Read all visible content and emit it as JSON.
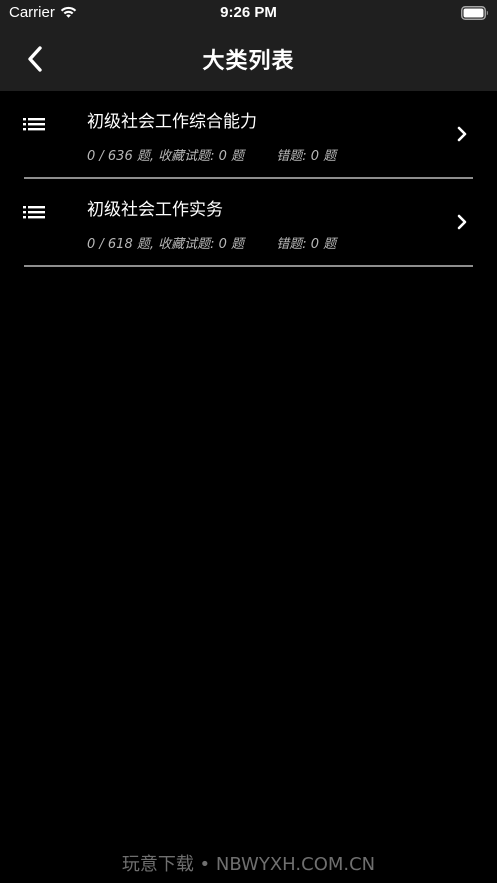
{
  "status_bar": {
    "carrier": "Carrier",
    "time": "9:26 PM",
    "wifi_icon": "wifi-icon",
    "battery_icon": "battery-icon"
  },
  "nav": {
    "title": "大类列表",
    "back_icon": "chevron-left-icon"
  },
  "items": [
    {
      "title": "初级社会工作综合能力",
      "progress": "0 / 636 题,",
      "favorites": "收藏试题: 0 题",
      "wrong": "错题: 0 题",
      "icon": "list-icon",
      "chevron": "chevron-right-icon"
    },
    {
      "title": "初级社会工作实务",
      "progress": "0 / 618 题,",
      "favorites": "收藏试题: 0 题",
      "wrong": "错题: 0 题",
      "icon": "list-icon",
      "chevron": "chevron-right-icon"
    }
  ],
  "watermark": "玩意下载 • NBWYXH.COM.CN",
  "colors": {
    "background": "#000000",
    "bar": "#1f1f1f",
    "subtext": "#b8b8b8",
    "divider": "#8e8e8e"
  }
}
